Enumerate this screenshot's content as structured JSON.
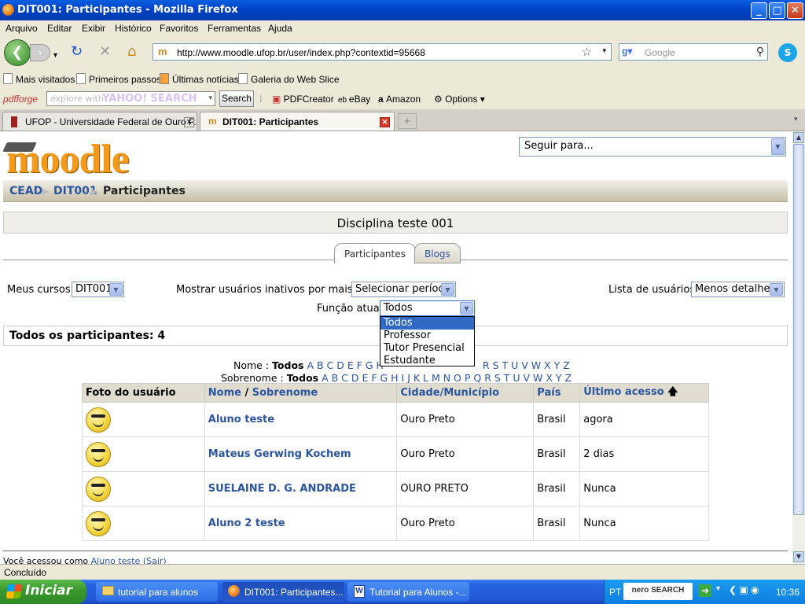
{
  "window": {
    "title": "DIT001: Participantes - Mozilla Firefox",
    "buttons": {
      "minimize": "_",
      "maximize": "□",
      "close": "✕"
    }
  },
  "menu": [
    "Arquivo",
    "Editar",
    "Exibir",
    "Histórico",
    "Favoritos",
    "Ferramentas",
    "Ajuda"
  ],
  "nav": {
    "url": "http://www.moodle.ufop.br/user/index.php?contextid=95668",
    "search_placeholder": "Google"
  },
  "bookmarks": [
    "Mais visitados",
    "Primeiros passos",
    "Últimas notícias",
    "Galeria do Web Slice"
  ],
  "pdfbar": {
    "brand": "pdfforge",
    "yahoo_hint": "explore with",
    "yahoo_logo": "YAHOO! SEARCH",
    "search_btn": "Search",
    "items": [
      "PDFCreator",
      "eBay",
      "Amazon",
      "Options"
    ]
  },
  "tabs": [
    {
      "label": "UFOP - Universidade Federal de Ouro P..."
    },
    {
      "label": "DIT001: Participantes"
    }
  ],
  "page": {
    "logo": "moodle",
    "jump_to": "Seguir para...",
    "breadcrumb": [
      "CEAD",
      "DIT001",
      "Participantes"
    ],
    "course_title": "Disciplina teste 001",
    "page_tabs": [
      "Participantes",
      "Blogs"
    ],
    "filters": {
      "my_courses_label": "Meus cursos",
      "my_courses_value": "DIT001",
      "inactive_label": "Mostrar usuários inativos por mais de",
      "inactive_value": "Selecionar período",
      "list_label": "Lista de usuários",
      "list_value": "Menos detalhes",
      "role_label": "Função atual",
      "role_value": "Todos",
      "role_options": [
        "Todos",
        "Professor",
        "Tutor Presencial",
        "Estudante"
      ]
    },
    "all_participants": "Todos os participantes: 4",
    "name_filter": {
      "label": "Nome :",
      "all": "Todos",
      "letters_before": "A B C D E F G H",
      "letters_after": "R S T U V W X Y Z"
    },
    "surname_filter": {
      "label": "Sobrenome :",
      "all": "Todos",
      "letters": "A B C D E F G H I J K L M N O P Q R S T U V W X Y Z"
    },
    "table": {
      "headers": {
        "photo": "Foto do usuário",
        "name": "Nome",
        "slash": "/",
        "surname": "Sobrenome",
        "city": "Cidade/Município",
        "country": "País",
        "last_access": "Último acesso"
      },
      "rows": [
        {
          "name": "Aluno teste",
          "city": "Ouro Preto",
          "country": "Brasil",
          "last": "agora"
        },
        {
          "name": "Mateus Gerwing Kochem",
          "city": "Ouro Preto",
          "country": "Brasil",
          "last": "2 dias"
        },
        {
          "name": "SUELAINE D. G. ANDRADE",
          "city": "OURO PRETO",
          "country": "Brasil",
          "last": "Nunca"
        },
        {
          "name": "Aluno 2 teste",
          "city": "Ouro Preto",
          "country": "Brasil",
          "last": "Nunca"
        }
      ]
    },
    "footer": {
      "prefix": "Você acessou como",
      "user": "Aluno teste",
      "logout": "(Sair)"
    }
  },
  "status": "Concluído",
  "taskbar": {
    "start": "Iniciar",
    "tasks": [
      "tutorial para alunos",
      "DIT001: Participantes...",
      "Tutorial para Alunos -..."
    ],
    "lang": "PT",
    "nero": "nero SEARCH",
    "clock": "10:36"
  }
}
